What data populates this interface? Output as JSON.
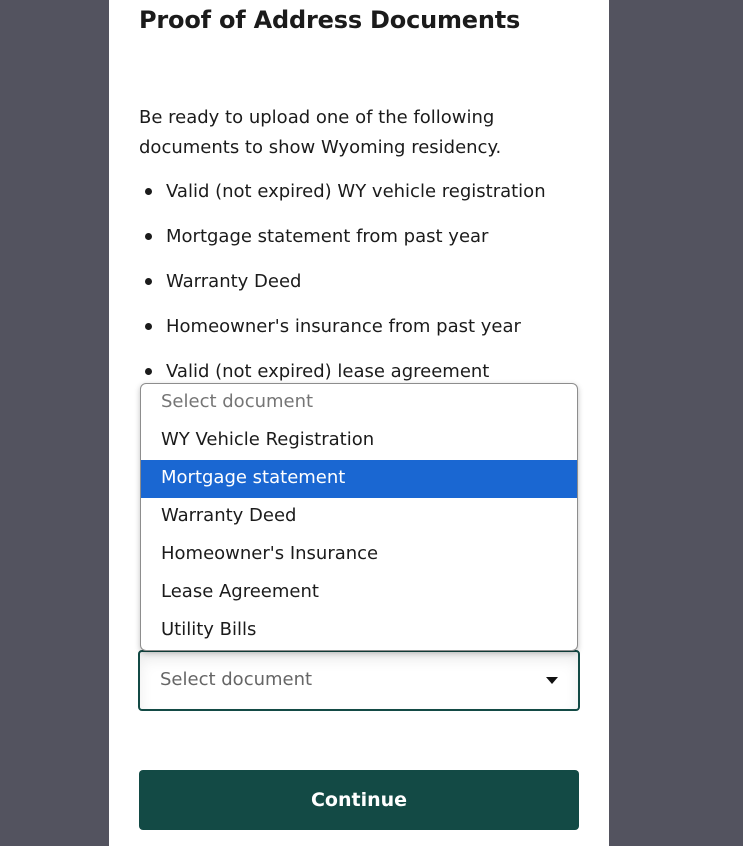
{
  "page": {
    "title": "Proof of Address Documents",
    "intro": "Be ready to upload one of the following documents to show Wyoming residency.",
    "documents": [
      "Valid (not expired) WY vehicle registration",
      "Mortgage statement from past year",
      "Warranty Deed",
      "Homeowner's insurance from past year",
      "Valid (not expired) lease agreement"
    ]
  },
  "select": {
    "value": "Select document",
    "options": [
      "Select document",
      "WY Vehicle Registration",
      "Mortgage statement",
      "Warranty Deed",
      "Homeowner's Insurance",
      "Lease Agreement",
      "Utility Bills"
    ],
    "highlighted": "Mortgage statement"
  },
  "actions": {
    "continue_label": "Continue"
  },
  "colors": {
    "backdrop": "#53535f",
    "primary": "#134a45",
    "highlight": "#1a67d2"
  }
}
